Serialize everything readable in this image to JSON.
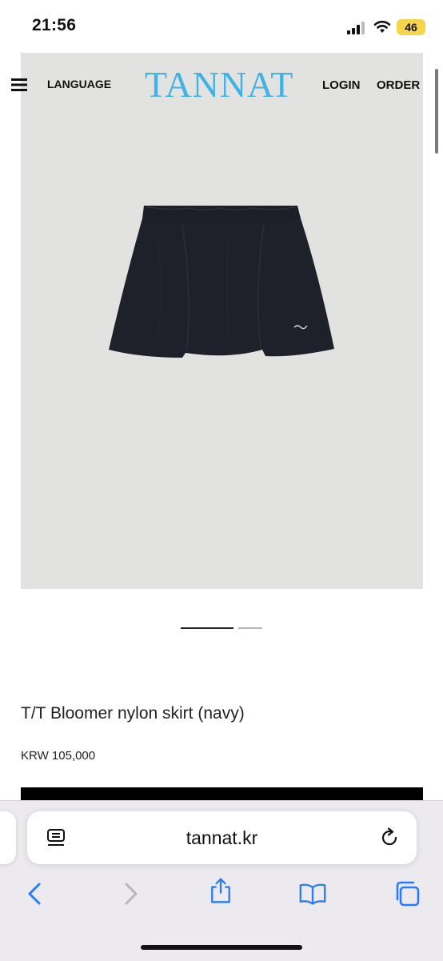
{
  "status_bar": {
    "time": "21:56",
    "battery": "46",
    "battery_color": "#f7d54a",
    "icons": [
      "signal-icon",
      "wifi-icon",
      "battery-icon"
    ]
  },
  "site_header": {
    "language_label": "LANGUAGE",
    "logo_text": "TANNAT",
    "logo_color": "#3fb2e6",
    "login_label": "LOGIN",
    "order_label": "ORDER",
    "menu_icon": "hamburger-icon"
  },
  "product": {
    "image_subject": "navy nylon bloomer skirt",
    "image_background": "#e2e2e0",
    "carousel": {
      "total": 2,
      "active": 1
    },
    "title": "T/T Bloomer nylon skirt (navy)",
    "price": "KRW 105,000"
  },
  "browser": {
    "url": "tannat.kr",
    "icons": [
      "reader-icon",
      "reload-icon",
      "back-icon",
      "forward-icon",
      "share-icon",
      "bookmarks-icon",
      "tabs-icon"
    ]
  }
}
